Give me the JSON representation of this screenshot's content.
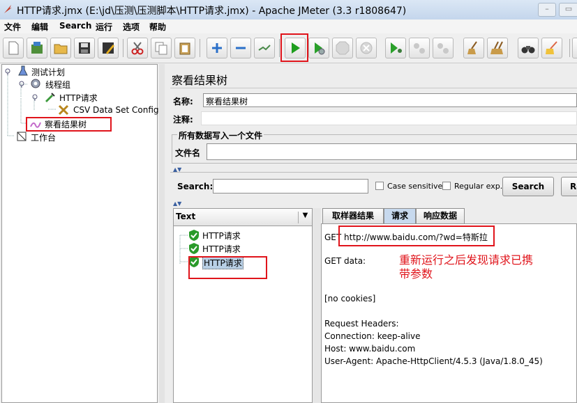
{
  "window": {
    "title": "HTTP请求.jmx (E:\\jd\\压测\\压测脚本\\HTTP请求.jmx) - Apache JMeter (3.3 r1808647)"
  },
  "menu": [
    "文件",
    "编辑",
    "Search",
    "运行",
    "选项",
    "帮助"
  ],
  "tree": {
    "plan": "测试计划",
    "thread_group": "线程组",
    "http_sampler": "HTTP请求",
    "csv_config": "CSV Data Set Config",
    "listener": "察看结果树",
    "workbench": "工作台"
  },
  "panel": {
    "title": "察看结果树",
    "name_label": "名称:",
    "name_value": "察看结果树",
    "comment_label": "注释:",
    "comment_value": "",
    "file_section": "所有数据写入一个文件",
    "file_label": "文件名",
    "file_value": ""
  },
  "search": {
    "label": "Search:",
    "value": "",
    "case_sensitive": "Case sensitive",
    "regex": "Regular exp.",
    "search_button": "Search",
    "reset_button": "Re"
  },
  "results": {
    "renderer": "Text",
    "items": [
      "HTTP请求",
      "HTTP请求",
      "HTTP请求"
    ],
    "selected_index": 2
  },
  "tabs": [
    "取样器结果",
    "请求",
    "响应数据"
  ],
  "active_tab": 1,
  "request": {
    "line1": "GET http://www.baidu.com/?wd=特斯拉",
    "get_data": "GET data:",
    "cookies": "[no cookies]",
    "headers_title": "Request Headers:",
    "connection": "Connection: keep-alive",
    "host": "Host: www.baidu.com",
    "user_agent": "User-Agent: Apache-HttpClient/4.5.3 (Java/1.8.0_45)"
  },
  "annotation": {
    "line1": "重新运行之后发现请求已携",
    "line2": "带参数"
  },
  "colors": {
    "annotation_red": "#e0141b",
    "start_green": "#1e9e1e",
    "selection_blue": "#b8cfe5"
  }
}
